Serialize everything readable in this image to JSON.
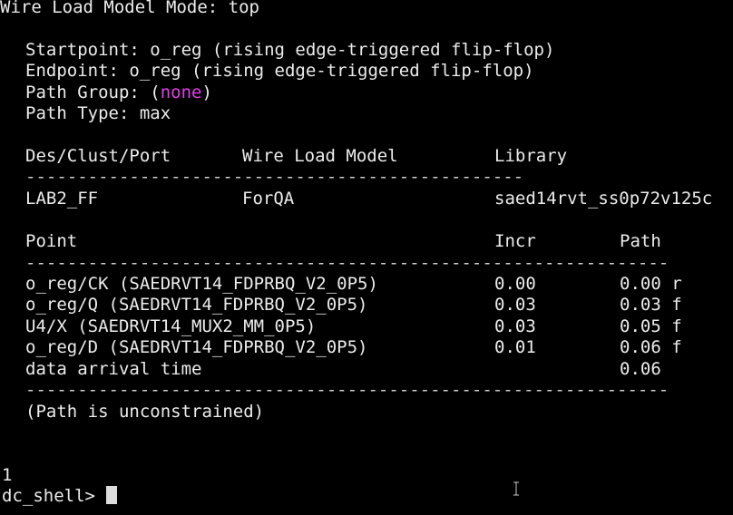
{
  "header": {
    "wire_load_mode": "Wire Load Model Mode: top"
  },
  "path_info": {
    "startpoint": "Startpoint: o_reg (rising edge-triggered flip-flop)",
    "endpoint": "Endpoint: o_reg (rising edge-triggered flip-flop)",
    "path_group_prefix": "Path Group: (",
    "path_group_value": "none",
    "path_group_suffix": ")",
    "path_type": "Path Type: max"
  },
  "wire_load_table": {
    "headers": [
      "Des/Clust/Port",
      "Wire Load Model",
      "Library"
    ],
    "separator": "------------------------------------------------",
    "rows": [
      [
        "LAB2_FF",
        "ForQA",
        "saed14rvt_ss0p72v125c"
      ]
    ]
  },
  "timing_table": {
    "headers": [
      "Point",
      "Incr",
      "Path"
    ],
    "separator": "--------------------------------------------------------------",
    "rows": [
      {
        "point": "o_reg/CK (SAEDRVT14_FDPRBQ_V2_0P5)",
        "incr": "0.00",
        "path": "0.00 r"
      },
      {
        "point": "o_reg/Q (SAEDRVT14_FDPRBQ_V2_0P5)",
        "incr": "0.03",
        "path": "0.03 f"
      },
      {
        "point": "U4/X (SAEDRVT14_MUX2_MM_0P5)",
        "incr": "0.03",
        "path": "0.05 f"
      },
      {
        "point": "o_reg/D (SAEDRVT14_FDPRBQ_V2_0P5)",
        "incr": "0.01",
        "path": "0.06 f"
      },
      {
        "point": "data arrival time",
        "incr": "",
        "path": "0.06"
      }
    ],
    "footer_separator": "--------------------------------------------------------------",
    "note": "(Path is unconstrained)"
  },
  "shell": {
    "return_value": "1",
    "prompt": "dc_shell> "
  },
  "colors": {
    "background": "#000000",
    "foreground": "#ececec",
    "highlight": "#e040e8"
  }
}
